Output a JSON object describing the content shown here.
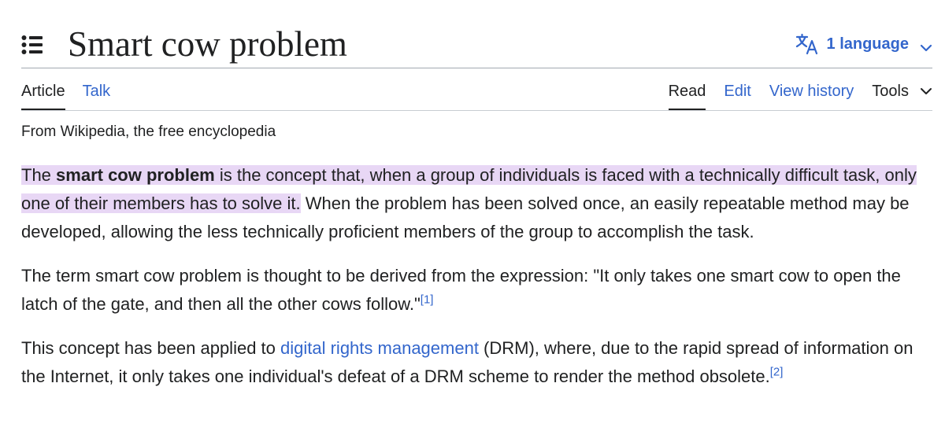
{
  "header": {
    "title": "Smart cow problem",
    "language_label": "1 language"
  },
  "tabs": {
    "left": [
      {
        "label": "Article"
      },
      {
        "label": "Talk"
      }
    ],
    "right": [
      {
        "label": "Read"
      },
      {
        "label": "Edit"
      },
      {
        "label": "View history"
      },
      {
        "label": "Tools"
      }
    ]
  },
  "tagline": "From Wikipedia, the free encyclopedia",
  "paragraphs": {
    "p1": {
      "lead": "The ",
      "bold": "smart cow problem",
      "highlight_rest": " is the concept that, when a group of individuals is faced with a technically difficult task, only one of their members has to solve it.",
      "rest": " When the problem has been solved once, an easily repeatable method may be developed, allowing the less technically proficient members of the group to accomplish the task."
    },
    "p2": {
      "text": "The term smart cow problem is thought to be derived from the expression: \"It only takes one smart cow to open the latch of the gate, and then all the other cows follow.\"",
      "ref": "[1]"
    },
    "p3": {
      "before": "This concept has been applied to ",
      "link": "digital rights management",
      "after": " (DRM), where, due to the rapid spread of information on the Internet, it only takes one individual's defeat of a DRM scheme to render the method obsolete.",
      "ref": "[2]"
    }
  },
  "colors": {
    "link": "#3366cc",
    "text": "#202122",
    "highlight": "#e8d7f5",
    "rule": "#a2a9b1"
  },
  "icons": {
    "toc": "list-bullet-icon",
    "language": "translate-icon",
    "chevron": "chevron-down-icon"
  }
}
